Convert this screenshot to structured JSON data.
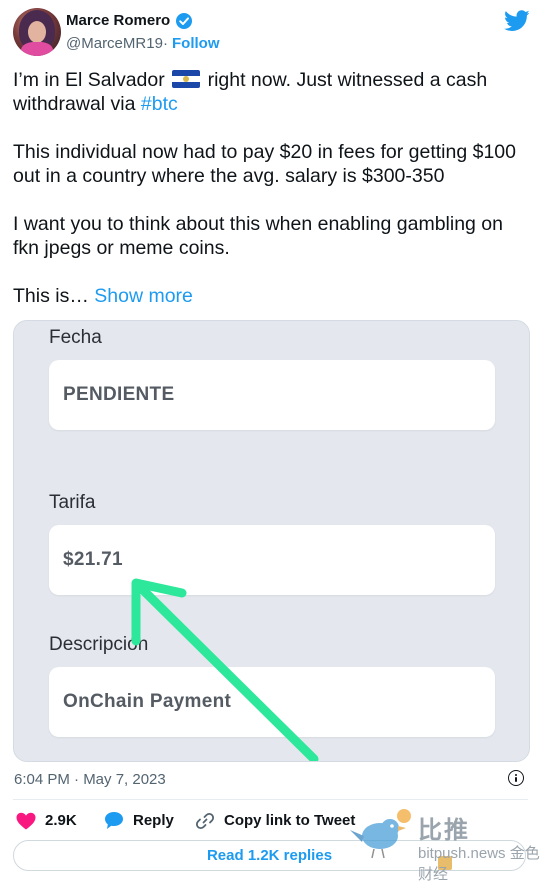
{
  "author": {
    "name": "Marce Romero",
    "handle": "@MarceMR19",
    "separator": "·",
    "follow_label": "Follow"
  },
  "tweet": {
    "line1_before_flag": "I’m in El Salvador",
    "line1_after_flag": "right now. Just witnessed a cash",
    "line2_before_link": "withdrawal via ",
    "hashtag": "#btc",
    "para2_line1": "This individual now had to pay $20 in fees for getting $100",
    "para2_line2": "out in a country where the avg. salary is $300-350",
    "para3_line1": "I want you to think about this when enabling gambling on",
    "para3_line2": "fkn jpegs or meme coins.",
    "para4_prefix": "This is…",
    "show_more": "Show more"
  },
  "media": {
    "fields": [
      {
        "label": "Fecha",
        "value": "PENDIENTE"
      },
      {
        "label": "Tarifa",
        "value": "$21.71"
      },
      {
        "label": "Descripción",
        "value": "OnChain Payment"
      }
    ],
    "arrow_color": "#2de89b"
  },
  "footer": {
    "timestamp": "6:04 PM · May 7, 2023",
    "like_count": "2.9K",
    "reply_label": "Reply",
    "copy_link_label": "Copy link to Tweet",
    "read_replies_label": "Read 1.2K replies"
  },
  "watermark": {
    "brand_cn": "比推",
    "url_text": "bitpush.news",
    "badge_cn": "金色财经"
  },
  "colors": {
    "accent": "#1d9bf0",
    "like": "#f91880",
    "text": "#0f1419",
    "muted": "#536471"
  },
  "icons": [
    "twitter-bird-icon",
    "verified-badge-icon",
    "heart-icon",
    "reply-bubble-icon",
    "link-icon",
    "info-icon",
    "flag-el-salvador-icon"
  ]
}
